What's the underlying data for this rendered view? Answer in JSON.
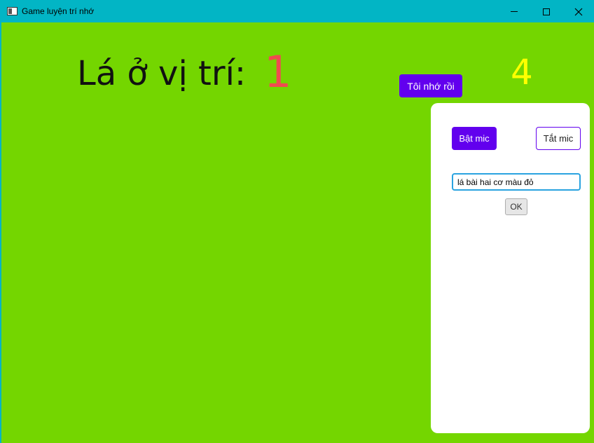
{
  "window": {
    "title": "Game luyện trí nhớ",
    "controls": {
      "minimize_icon": "minimize-icon",
      "maximize_icon": "maximize-icon",
      "close_icon": "close-icon"
    }
  },
  "colors": {
    "titlebar": "#02b5c5",
    "background": "#74d600",
    "accent": "#6200ee",
    "position_value": "#f04b50",
    "counter": "#ffff00"
  },
  "game": {
    "position_label": "Lá ở vị trí:",
    "position_value": "1",
    "counter": "4",
    "remember_button": "Tôi nhớ rồi"
  },
  "panel": {
    "mic_on_label": "Bật mic",
    "mic_off_label": "Tắt mic",
    "speech_input_value": "lá bài hai cơ màu đỏ",
    "ok_label": "OK"
  }
}
